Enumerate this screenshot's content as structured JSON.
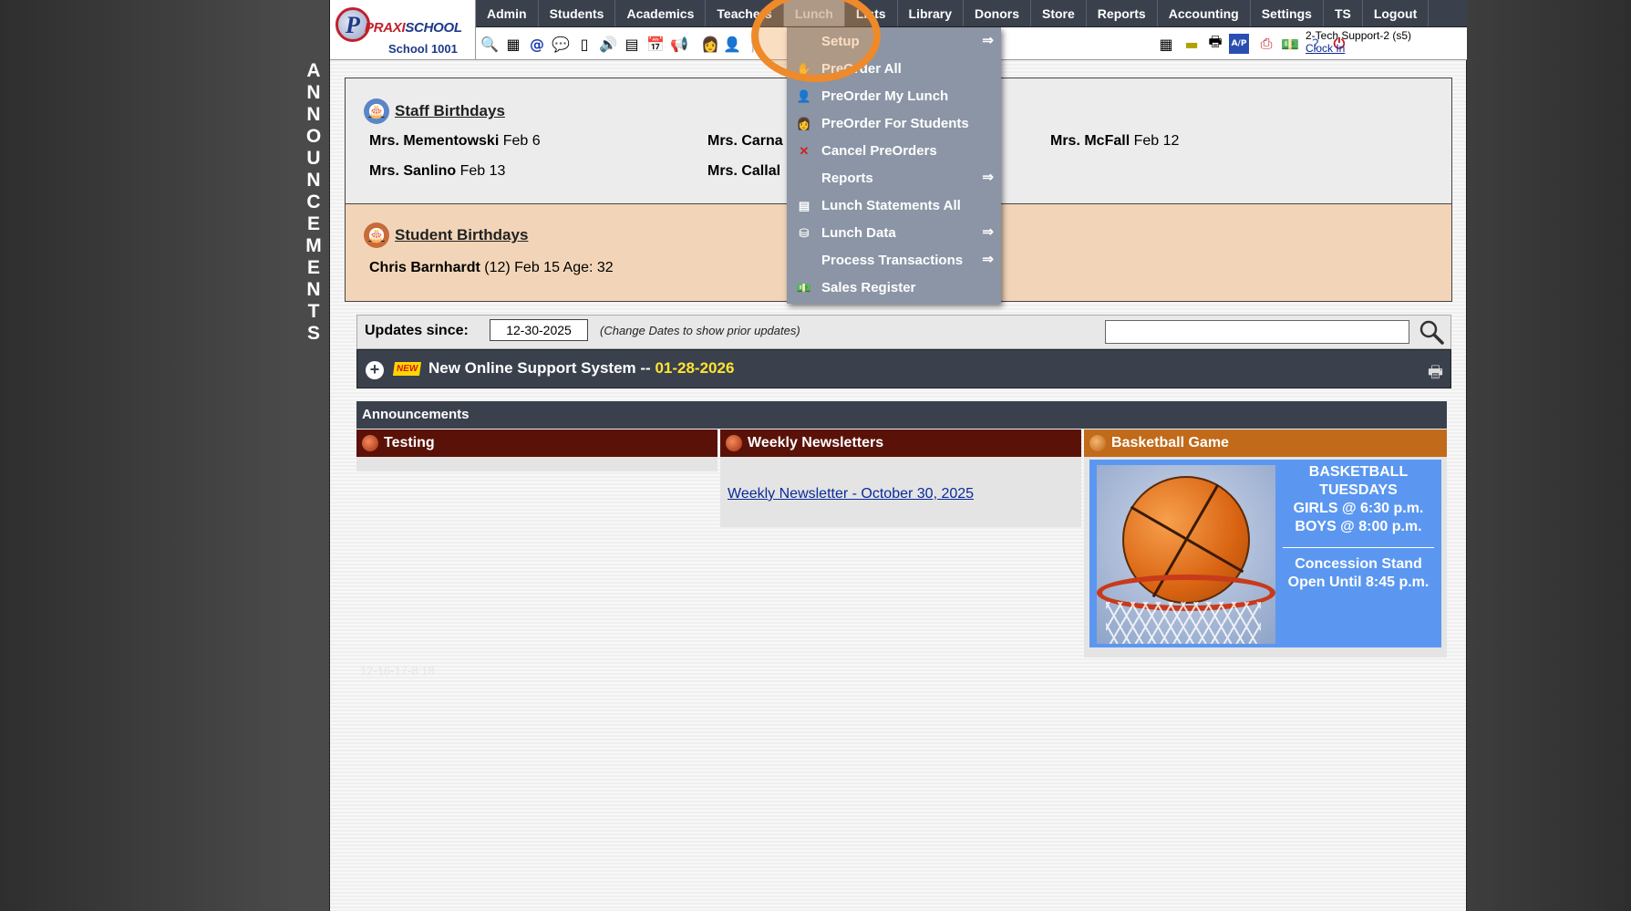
{
  "side_banner": {
    "letters": [
      "A",
      "N",
      "N",
      "O",
      "U",
      "N",
      "C",
      "E",
      "M",
      "E",
      "N",
      "T",
      "S"
    ]
  },
  "logo": {
    "brand_praxi": "PRAXI",
    "brand_school": "SCHOOL",
    "school_name": "School 1001"
  },
  "menu": {
    "items": [
      "Admin",
      "Students",
      "Academics",
      "Teachers",
      "Lunch",
      "Lists",
      "Library",
      "Donors",
      "Store",
      "Reports",
      "Accounting",
      "Settings",
      "TS",
      "Logout"
    ],
    "active": "Lunch"
  },
  "toolbar": {
    "icons": [
      "search-icon",
      "calendar-grid-icon",
      "email-icon",
      "chat-icon",
      "mobile-icon",
      "speaker-icon",
      "report-icon",
      "calendar-icon",
      "megaphone-icon",
      "teacher-icon",
      "student-icon",
      "lunch-icon",
      "table-icon",
      "card-icon",
      "printer-icon",
      "ap-icon",
      "pdf-icon",
      "money-icon",
      "help-icon",
      "power-icon"
    ]
  },
  "user": {
    "name": "2-Tech Support-2 (s5)",
    "clock_link": "Clock In"
  },
  "staff_birthdays": {
    "title": "Staff Birthdays",
    "people": [
      {
        "name": "Mrs. Mementowski",
        "date": "Feb 6"
      },
      {
        "name": "Mrs. Carna",
        "date": ""
      },
      {
        "name": "Mrs. McFall",
        "date": "Feb 12"
      },
      {
        "name": "Mrs. Sanlino",
        "date": "Feb 13"
      },
      {
        "name": "Mrs. Callal",
        "date": ""
      }
    ]
  },
  "student_birthdays": {
    "title": "Student Birthdays",
    "people": [
      {
        "name": "Chris Barnhardt",
        "detail": "(12) Feb 15 Age: 32"
      }
    ]
  },
  "updates": {
    "label": "Updates since:",
    "date_value": "12-30-2025",
    "hint": "(Change Dates to show prior updates)",
    "search_value": ""
  },
  "support": {
    "badge": "NEW",
    "title": "New Online Support System --",
    "date": "01-28-2026"
  },
  "announcements": {
    "header": "Announcements",
    "columns": [
      {
        "title": "Testing",
        "color": "#5a1208"
      },
      {
        "title": "Weekly Newsletters",
        "color": "#5a1208",
        "link": "Weekly Newsletter - October 30, 2025"
      },
      {
        "title": "Basketball Game",
        "color": "#c06a1a"
      }
    ],
    "basketball": {
      "line1": "BASKETBALL",
      "line2": "TUESDAYS",
      "line3": "GIRLS @ 6:30 p.m.",
      "line4": "BOYS  @ 8:00 p.m.",
      "line5": "Concession Stand",
      "line6": "Open Until 8:45 p.m."
    }
  },
  "faint_text": "12-16-17-8:18",
  "lunch_menu": {
    "items": [
      {
        "label": "Setup",
        "icon": "",
        "submenu": true
      },
      {
        "label": "PreOrder All",
        "icon": "preorder-all-icon",
        "submenu": false
      },
      {
        "label": "PreOrder My Lunch",
        "icon": "preorder-my-lunch-icon",
        "submenu": false
      },
      {
        "label": "PreOrder For Students",
        "icon": "preorder-students-icon",
        "submenu": false
      },
      {
        "label": "Cancel PreOrders",
        "icon": "cancel-icon",
        "submenu": false
      },
      {
        "label": "Reports",
        "icon": "",
        "submenu": true
      },
      {
        "label": "Lunch Statements All",
        "icon": "statements-icon",
        "submenu": false
      },
      {
        "label": "Lunch Data",
        "icon": "database-icon",
        "submenu": true
      },
      {
        "label": "Process Transactions",
        "icon": "",
        "submenu": true
      },
      {
        "label": "Sales Register",
        "icon": "register-icon",
        "submenu": false
      }
    ],
    "arrow_glyph": "⇒"
  }
}
